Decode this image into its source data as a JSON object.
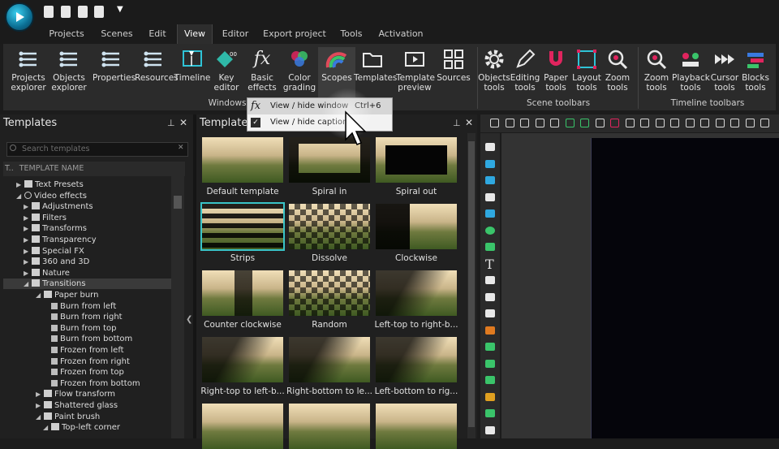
{
  "menu": {
    "tabs": [
      {
        "label": "Projects"
      },
      {
        "label": "Scenes"
      },
      {
        "label": "Edit"
      },
      {
        "label": "View"
      },
      {
        "label": "Editor"
      },
      {
        "label": "Export project"
      },
      {
        "label": "Tools"
      },
      {
        "label": "Activation"
      }
    ],
    "active": "View"
  },
  "ribbon": {
    "windows_buttons": [
      {
        "label": "Projects\nexplorer",
        "icon": "projects-explorer-icon"
      },
      {
        "label": "Objects\nexplorer",
        "icon": "objects-explorer-icon"
      },
      {
        "label": "Properties",
        "icon": "properties-icon"
      },
      {
        "label": "Resources",
        "icon": "resources-icon"
      },
      {
        "label": "Timeline",
        "icon": "timeline-icon"
      },
      {
        "label": "Key\neditor",
        "icon": "key-editor-icon"
      },
      {
        "label": "Basic\neffects",
        "icon": "fx-icon"
      },
      {
        "label": "Color\ngrading",
        "icon": "color-grading-icon"
      },
      {
        "label": "Scopes",
        "icon": "scopes-icon"
      },
      {
        "label": "Templates",
        "icon": "folder-icon"
      },
      {
        "label": "Template\npreview",
        "icon": "template-preview-icon"
      },
      {
        "label": "Sources",
        "icon": "sources-icon"
      }
    ],
    "scene_buttons": [
      {
        "label": "Objects\ntools",
        "icon": "gear-icon"
      },
      {
        "label": "Editing\ntools",
        "icon": "pencil-icon"
      },
      {
        "label": "Paper\ntools",
        "icon": "magnet-icon"
      },
      {
        "label": "Layout\ntools",
        "icon": "layout-icon"
      },
      {
        "label": "Zoom\ntools",
        "icon": "zoom-icon"
      }
    ],
    "timeline_buttons": [
      {
        "label": "Zoom\ntools",
        "icon": "zoom-icon"
      },
      {
        "label": "Playback\ntools",
        "icon": "playback-icon"
      },
      {
        "label": "Cursor\ntools",
        "icon": "cursor-tools-icon"
      },
      {
        "label": "Blocks\ntools",
        "icon": "blocks-icon"
      }
    ],
    "groups": {
      "windows": "Windows",
      "scene": "Scene toolbars",
      "timeline": "Timeline toolbars"
    }
  },
  "popup": {
    "items": [
      {
        "label": "View / hide window",
        "shortcut": "Ctrl+6"
      },
      {
        "label": "View / hide caption",
        "shortcut": ""
      }
    ]
  },
  "left_panel": {
    "title": "Templates",
    "search_placeholder": "Search templates",
    "column_t": "T..",
    "column_name": "TEMPLATE NAME",
    "tree": [
      {
        "label": "Text Presets",
        "depth": 1,
        "icon": "folder"
      },
      {
        "label": "Video effects",
        "depth": 1,
        "icon": "fx"
      },
      {
        "label": "Adjustments",
        "depth": 2,
        "icon": "folder"
      },
      {
        "label": "Filters",
        "depth": 2,
        "icon": "folder"
      },
      {
        "label": "Transforms",
        "depth": 2,
        "icon": "folder"
      },
      {
        "label": "Transparency",
        "depth": 2,
        "icon": "folder"
      },
      {
        "label": "Special FX",
        "depth": 2,
        "icon": "folder"
      },
      {
        "label": "360 and 3D",
        "depth": 2,
        "icon": "folder"
      },
      {
        "label": "Nature",
        "depth": 2,
        "icon": "folder"
      },
      {
        "label": "Transitions",
        "depth": 2,
        "icon": "folder"
      },
      {
        "label": "Paper burn",
        "depth": 3,
        "icon": "folder"
      },
      {
        "label": "Burn from left",
        "depth": 4,
        "icon": "item"
      },
      {
        "label": "Burn from right",
        "depth": 4,
        "icon": "item"
      },
      {
        "label": "Burn from top",
        "depth": 4,
        "icon": "item"
      },
      {
        "label": "Burn from bottom",
        "depth": 4,
        "icon": "item"
      },
      {
        "label": "Frozen from left",
        "depth": 4,
        "icon": "item"
      },
      {
        "label": "Frozen from right",
        "depth": 4,
        "icon": "item"
      },
      {
        "label": "Frozen from top",
        "depth": 4,
        "icon": "item"
      },
      {
        "label": "Frozen from bottom",
        "depth": 4,
        "icon": "item"
      },
      {
        "label": "Flow transform",
        "depth": 3,
        "icon": "folder"
      },
      {
        "label": "Shattered glass",
        "depth": 3,
        "icon": "folder"
      },
      {
        "label": "Paint brush",
        "depth": 3,
        "icon": "folder"
      },
      {
        "label": "Top-left corner",
        "depth": 4,
        "icon": "folder"
      }
    ]
  },
  "center_panel": {
    "title": "Template",
    "thumbs": [
      {
        "label": "Default template",
        "style": "plain"
      },
      {
        "label": "Spiral in",
        "style": "spiral"
      },
      {
        "label": "Spiral out",
        "style": "spiralout"
      },
      {
        "label": "Strips",
        "style": "strips"
      },
      {
        "label": "Dissolve",
        "style": "dissolve"
      },
      {
        "label": "Clockwise",
        "style": "clockwise"
      },
      {
        "label": "Counter clockwise",
        "style": "ccw"
      },
      {
        "label": "Random",
        "style": "random"
      },
      {
        "label": "Left-top to right-b...",
        "style": "diag"
      },
      {
        "label": "Right-top to left-b...",
        "style": "diag"
      },
      {
        "label": "Right-bottom to le...",
        "style": "diag"
      },
      {
        "label": "Left-bottom to rig...",
        "style": "diag"
      },
      {
        "label": "",
        "style": "plain"
      },
      {
        "label": "",
        "style": "plain"
      },
      {
        "label": "",
        "style": "plain"
      }
    ],
    "selected": "Strips"
  },
  "colors": {
    "accent": "#39c4c8",
    "background": "#1c1c1c",
    "panel": "#202020",
    "ribbon": "#2b2b2b"
  }
}
